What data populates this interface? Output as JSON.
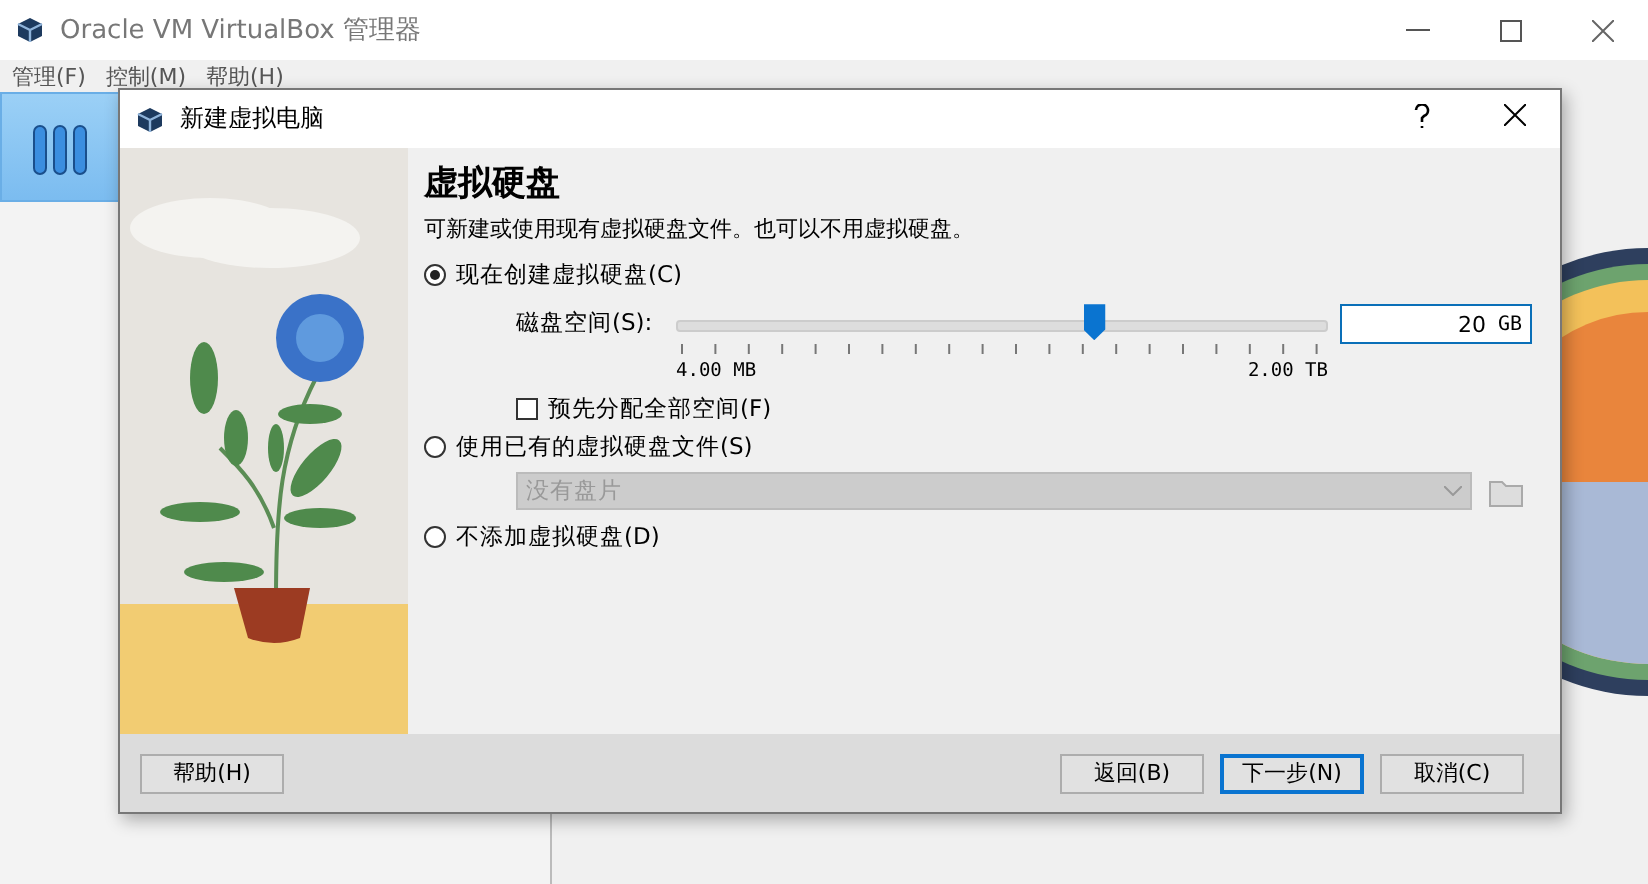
{
  "window": {
    "title": "Oracle VM VirtualBox 管理器"
  },
  "menu": [
    "管理(F)",
    "控制(M)",
    "帮助(H)"
  ],
  "dialog": {
    "title": "新建虚拟电脑",
    "heading": "虚拟硬盘",
    "description": "可新建或使用现有虚拟硬盘文件。也可以不用虚拟硬盘。",
    "options": [
      {
        "label": "现在创建虚拟硬盘(C)",
        "selected": true
      },
      {
        "label": "使用已有的虚拟硬盘文件(S)",
        "selected": false
      },
      {
        "label": "不添加虚拟硬盘(D)",
        "selected": false
      }
    ],
    "disk_size": {
      "label": "磁盘空间(S):",
      "level": 0.64,
      "min_label": "4.00 MB",
      "max_label": "2.00 TB",
      "value": "20",
      "unit": "GB"
    },
    "preallocate": {
      "label": "预先分配全部空间(F)",
      "checked": false
    },
    "disk_file": {
      "value": "没有盘片",
      "disabled": true
    },
    "buttons": [
      {
        "label": "帮助(H)",
        "default": false
      },
      {
        "label": "返回(B)",
        "default": false
      },
      {
        "label": "下一步(N)",
        "default": true
      },
      {
        "label": "取消(C)",
        "default": false
      }
    ]
  }
}
